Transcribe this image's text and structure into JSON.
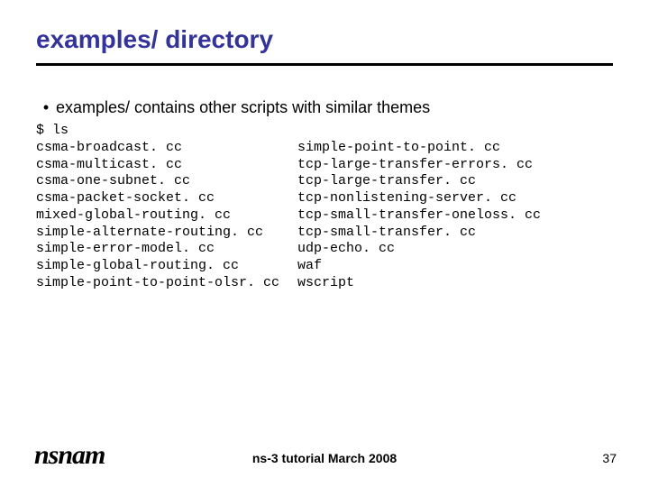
{
  "title": "examples/ directory",
  "bullet": "examples/ contains other scripts with similar themes",
  "listing": {
    "cmd": "$ ls",
    "rows": [
      {
        "l": "csma-broadcast. cc",
        "r": "simple-point-to-point. cc"
      },
      {
        "l": "csma-multicast. cc",
        "r": "tcp-large-transfer-errors. cc"
      },
      {
        "l": "csma-one-subnet. cc",
        "r": "tcp-large-transfer. cc"
      },
      {
        "l": "csma-packet-socket. cc",
        "r": "tcp-nonlistening-server. cc"
      },
      {
        "l": "mixed-global-routing. cc",
        "r": "tcp-small-transfer-oneloss. cc"
      },
      {
        "l": "simple-alternate-routing. cc",
        "r": "tcp-small-transfer. cc"
      },
      {
        "l": "simple-error-model. cc",
        "r": "udp-echo. cc"
      },
      {
        "l": "simple-global-routing. cc",
        "r": "waf"
      },
      {
        "l": "simple-point-to-point-olsr. cc",
        "r": "wscript"
      }
    ]
  },
  "footer": {
    "logo": "nsnam",
    "text": "ns-3 tutorial March 2008",
    "page": "37"
  }
}
